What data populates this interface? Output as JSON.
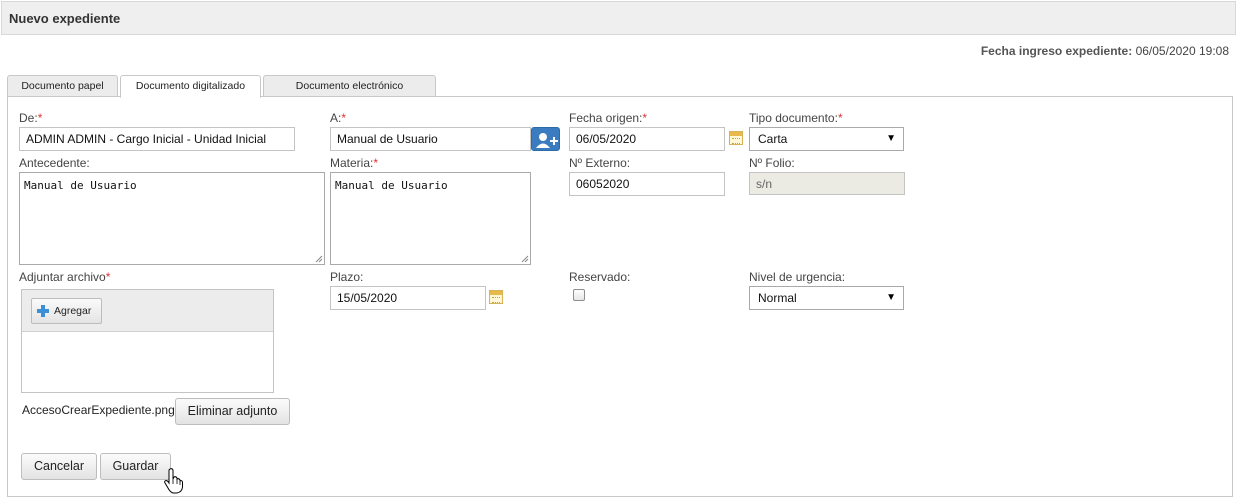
{
  "header": {
    "title": "Nuevo expediente"
  },
  "ingreso": {
    "label": "Fecha ingreso expediente:",
    "value": "06/05/2020 19:08"
  },
  "tabs": [
    {
      "label": "Documento papel",
      "active": false
    },
    {
      "label": "Documento digitalizado",
      "active": true
    },
    {
      "label": "Documento electrónico",
      "active": false
    }
  ],
  "form": {
    "de": {
      "label": "De:",
      "value": "ADMIN ADMIN - Cargo Inicial - Unidad Inicial"
    },
    "a": {
      "label": "A:",
      "value": "Manual de Usuario"
    },
    "fecha_origen": {
      "label": "Fecha origen:",
      "value": "06/05/2020"
    },
    "tipo_documento": {
      "label": "Tipo documento:",
      "value": "Carta"
    },
    "antecedente": {
      "label": "Antecedente:",
      "value": "Manual de Usuario"
    },
    "materia": {
      "label": "Materia:",
      "value": "Manual de Usuario"
    },
    "n_externo": {
      "label": "Nº Externo:",
      "value": "06052020"
    },
    "n_folio": {
      "label": "Nº Folio:",
      "value": "s/n"
    },
    "adjuntar": {
      "label": "Adjuntar archivo",
      "add_label": "Agregar",
      "file_name": "AccesoCrearExpediente.png",
      "remove_label": "Eliminar adjunto"
    },
    "plazo": {
      "label": "Plazo:",
      "value": "15/05/2020"
    },
    "reservado": {
      "label": "Reservado:",
      "checked": false
    },
    "nivel_urgencia": {
      "label": "Nivel de urgencia:",
      "value": "Normal"
    },
    "required_mark": "*"
  },
  "actions": {
    "cancel_label": "Cancelar",
    "save_label": "Guardar"
  },
  "colors": {
    "accent": "#3b7bbf",
    "required": "#dd3333",
    "header_bg": "#efefef"
  },
  "icons": {
    "calendar": "calendar-icon",
    "add_user": "add-user-icon",
    "plus": "plus-icon",
    "cursor": "hand-pointer-icon"
  }
}
